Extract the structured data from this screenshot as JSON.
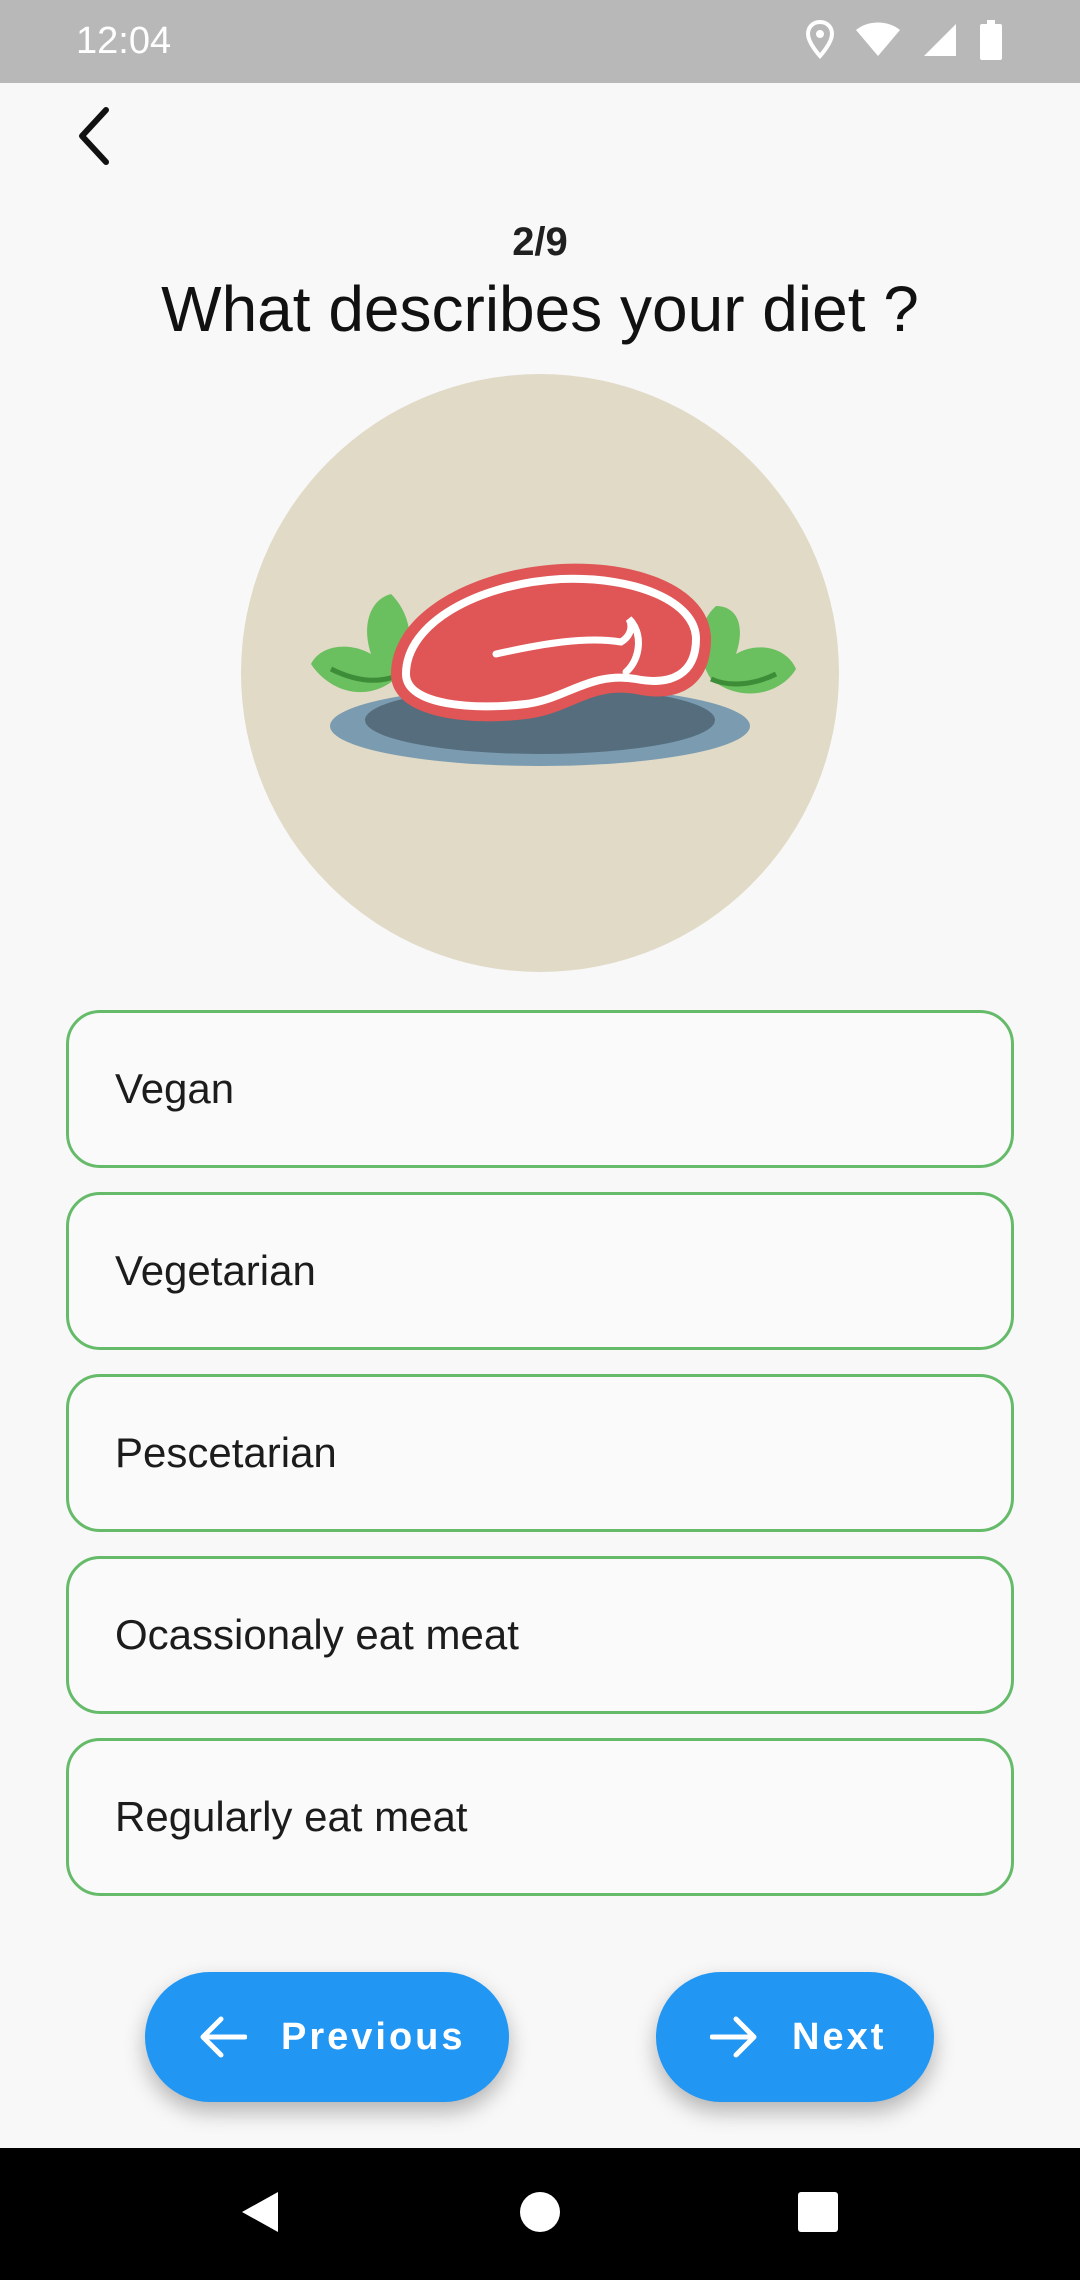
{
  "status_bar": {
    "time": "12:04",
    "icons": [
      "location-icon",
      "wifi-icon",
      "signal-icon",
      "battery-icon"
    ]
  },
  "header": {
    "back_icon": "chevron-left-icon",
    "progress": "2/9",
    "title": "What describes your diet ?"
  },
  "illustration": {
    "icon": "steak-plate-icon"
  },
  "options": [
    {
      "label": "Vegan"
    },
    {
      "label": "Vegetarian"
    },
    {
      "label": "Pescetarian"
    },
    {
      "label": "Ocassionaly eat meat"
    },
    {
      "label": "Regularly eat meat"
    }
  ],
  "buttons": {
    "previous_label": "Previous",
    "next_label": "Next",
    "previous_icon": "arrow-left-icon",
    "next_icon": "arrow-right-icon"
  },
  "system_nav": {
    "icons": [
      "back-triangle-icon",
      "home-circle-icon",
      "recents-square-icon"
    ]
  },
  "colors": {
    "accent": "#2196f3",
    "option_border": "#66bb6a",
    "illustration_bg": "#e0dac7",
    "status_bar": "#b8b8b8"
  }
}
